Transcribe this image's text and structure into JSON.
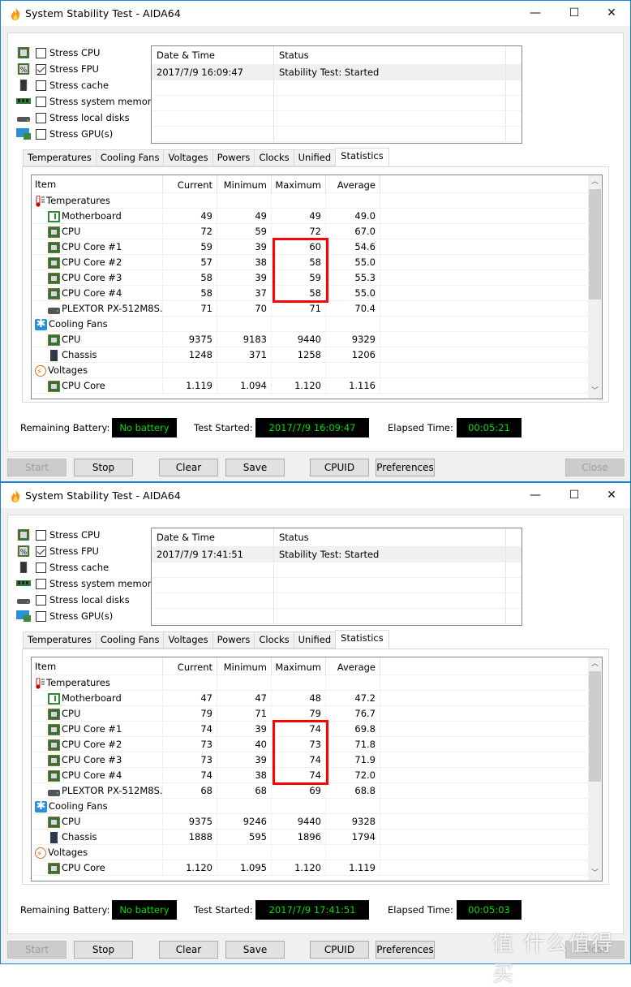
{
  "windows": [
    {
      "title": "System Stability Test - AIDA64",
      "window_controls": {
        "minimize": "—",
        "maximize": "☐",
        "close": "✕"
      },
      "stress_options": [
        {
          "label": "Stress CPU",
          "checked": false,
          "icon": "cpu-chip-icon"
        },
        {
          "label": "Stress FPU",
          "checked": true,
          "icon": "fpu-chip-icon"
        },
        {
          "label": "Stress cache",
          "checked": false,
          "icon": "cache-chip-icon"
        },
        {
          "label": "Stress system memory",
          "checked": false,
          "icon": "memory-module-icon"
        },
        {
          "label": "Stress local disks",
          "checked": false,
          "icon": "disk-drive-icon"
        },
        {
          "label": "Stress GPU(s)",
          "checked": false,
          "icon": "gpu-monitor-icon"
        }
      ],
      "log": {
        "headers": [
          "Date & Time",
          "Status"
        ],
        "rows": [
          {
            "datetime": "2017/7/9 16:09:47",
            "status": "Stability Test: Started"
          }
        ]
      },
      "tabs": [
        "Temperatures",
        "Cooling Fans",
        "Voltages",
        "Powers",
        "Clocks",
        "Unified",
        "Statistics"
      ],
      "active_tab": "Statistics",
      "stats": {
        "headers": [
          "Item",
          "Current",
          "Minimum",
          "Maximum",
          "Average"
        ],
        "rows": [
          {
            "type": "group",
            "item": "Temperatures",
            "icon": "thermometer-icon"
          },
          {
            "type": "item",
            "item": "Motherboard",
            "icon": "motherboard-icon",
            "current": "49",
            "minimum": "49",
            "maximum": "49",
            "average": "49.0"
          },
          {
            "type": "item",
            "item": "CPU",
            "icon": "cpu-chip-icon",
            "current": "72",
            "minimum": "59",
            "maximum": "72",
            "average": "67.0"
          },
          {
            "type": "item",
            "item": "CPU Core #1",
            "icon": "cpu-chip-icon",
            "current": "59",
            "minimum": "39",
            "maximum": "60",
            "average": "54.6"
          },
          {
            "type": "item",
            "item": "CPU Core #2",
            "icon": "cpu-chip-icon",
            "current": "57",
            "minimum": "38",
            "maximum": "58",
            "average": "55.0"
          },
          {
            "type": "item",
            "item": "CPU Core #3",
            "icon": "cpu-chip-icon",
            "current": "58",
            "minimum": "39",
            "maximum": "59",
            "average": "55.3"
          },
          {
            "type": "item",
            "item": "CPU Core #4",
            "icon": "cpu-chip-icon",
            "current": "58",
            "minimum": "37",
            "maximum": "58",
            "average": "55.0"
          },
          {
            "type": "item",
            "item": "PLEXTOR PX-512M8S...",
            "icon": "disk-drive-icon",
            "current": "71",
            "minimum": "70",
            "maximum": "71",
            "average": "70.4"
          },
          {
            "type": "group",
            "item": "Cooling Fans",
            "icon": "fan-icon"
          },
          {
            "type": "item",
            "item": "CPU",
            "icon": "cpu-chip-icon",
            "current": "9375",
            "minimum": "9183",
            "maximum": "9440",
            "average": "9329"
          },
          {
            "type": "item",
            "item": "Chassis",
            "icon": "chassis-icon",
            "current": "1248",
            "minimum": "371",
            "maximum": "1258",
            "average": "1206"
          },
          {
            "type": "group",
            "item": "Voltages",
            "icon": "voltage-icon"
          },
          {
            "type": "item",
            "item": "CPU Core",
            "icon": "cpu-chip-icon",
            "current": "1.119",
            "minimum": "1.094",
            "maximum": "1.120",
            "average": "1.116"
          }
        ]
      },
      "status": {
        "battery_label": "Remaining Battery:",
        "battery_value": "No battery",
        "started_label": "Test Started:",
        "started_value": "2017/7/9 16:09:47",
        "elapsed_label": "Elapsed Time:",
        "elapsed_value": "00:05:21"
      },
      "buttons": {
        "start": "Start",
        "stop": "Stop",
        "clear": "Clear",
        "save": "Save",
        "cpuid": "CPUID",
        "preferences": "Preferences",
        "close": "Close"
      }
    },
    {
      "title": "System Stability Test - AIDA64",
      "window_controls": {
        "minimize": "—",
        "maximize": "☐",
        "close": "✕"
      },
      "stress_options": [
        {
          "label": "Stress CPU",
          "checked": false,
          "icon": "cpu-chip-icon"
        },
        {
          "label": "Stress FPU",
          "checked": true,
          "icon": "fpu-chip-icon"
        },
        {
          "label": "Stress cache",
          "checked": false,
          "icon": "cache-chip-icon"
        },
        {
          "label": "Stress system memory",
          "checked": false,
          "icon": "memory-module-icon"
        },
        {
          "label": "Stress local disks",
          "checked": false,
          "icon": "disk-drive-icon"
        },
        {
          "label": "Stress GPU(s)",
          "checked": false,
          "icon": "gpu-monitor-icon"
        }
      ],
      "log": {
        "headers": [
          "Date & Time",
          "Status"
        ],
        "rows": [
          {
            "datetime": "2017/7/9 17:41:51",
            "status": "Stability Test: Started"
          }
        ]
      },
      "tabs": [
        "Temperatures",
        "Cooling Fans",
        "Voltages",
        "Powers",
        "Clocks",
        "Unified",
        "Statistics"
      ],
      "active_tab": "Statistics",
      "stats": {
        "headers": [
          "Item",
          "Current",
          "Minimum",
          "Maximum",
          "Average"
        ],
        "rows": [
          {
            "type": "group",
            "item": "Temperatures",
            "icon": "thermometer-icon"
          },
          {
            "type": "item",
            "item": "Motherboard",
            "icon": "motherboard-icon",
            "current": "47",
            "minimum": "47",
            "maximum": "48",
            "average": "47.2"
          },
          {
            "type": "item",
            "item": "CPU",
            "icon": "cpu-chip-icon",
            "current": "79",
            "minimum": "71",
            "maximum": "79",
            "average": "76.7"
          },
          {
            "type": "item",
            "item": "CPU Core #1",
            "icon": "cpu-chip-icon",
            "current": "74",
            "minimum": "39",
            "maximum": "74",
            "average": "69.8"
          },
          {
            "type": "item",
            "item": "CPU Core #2",
            "icon": "cpu-chip-icon",
            "current": "73",
            "minimum": "40",
            "maximum": "73",
            "average": "71.8"
          },
          {
            "type": "item",
            "item": "CPU Core #3",
            "icon": "cpu-chip-icon",
            "current": "73",
            "minimum": "39",
            "maximum": "74",
            "average": "71.9"
          },
          {
            "type": "item",
            "item": "CPU Core #4",
            "icon": "cpu-chip-icon",
            "current": "74",
            "minimum": "38",
            "maximum": "74",
            "average": "72.0"
          },
          {
            "type": "item",
            "item": "PLEXTOR PX-512M8S...",
            "icon": "disk-drive-icon",
            "current": "68",
            "minimum": "68",
            "maximum": "69",
            "average": "68.8"
          },
          {
            "type": "group",
            "item": "Cooling Fans",
            "icon": "fan-icon"
          },
          {
            "type": "item",
            "item": "CPU",
            "icon": "cpu-chip-icon",
            "current": "9375",
            "minimum": "9246",
            "maximum": "9440",
            "average": "9328"
          },
          {
            "type": "item",
            "item": "Chassis",
            "icon": "chassis-icon",
            "current": "1888",
            "minimum": "595",
            "maximum": "1896",
            "average": "1794"
          },
          {
            "type": "group",
            "item": "Voltages",
            "icon": "voltage-icon"
          },
          {
            "type": "item",
            "item": "CPU Core",
            "icon": "cpu-chip-icon",
            "current": "1.120",
            "minimum": "1.095",
            "maximum": "1.120",
            "average": "1.119"
          }
        ]
      },
      "status": {
        "battery_label": "Remaining Battery:",
        "battery_value": "No battery",
        "started_label": "Test Started:",
        "started_value": "2017/7/9 17:41:51",
        "elapsed_label": "Elapsed Time:",
        "elapsed_value": "00:05:03"
      },
      "buttons": {
        "start": "Start",
        "stop": "Stop",
        "clear": "Clear",
        "save": "Save",
        "cpuid": "CPUID",
        "preferences": "Preferences",
        "close": "Close"
      }
    }
  ],
  "annotation": {
    "highlight_color": "#ff0000",
    "highlighted_column": "Maximum",
    "highlighted_rows": [
      "CPU Core #1",
      "CPU Core #2",
      "CPU Core #3",
      "CPU Core #4"
    ]
  },
  "watermark": "值 什么值得买",
  "colors": {
    "status_bg": "#000000",
    "status_text": "#00e000",
    "title_border": "#1883d7"
  }
}
